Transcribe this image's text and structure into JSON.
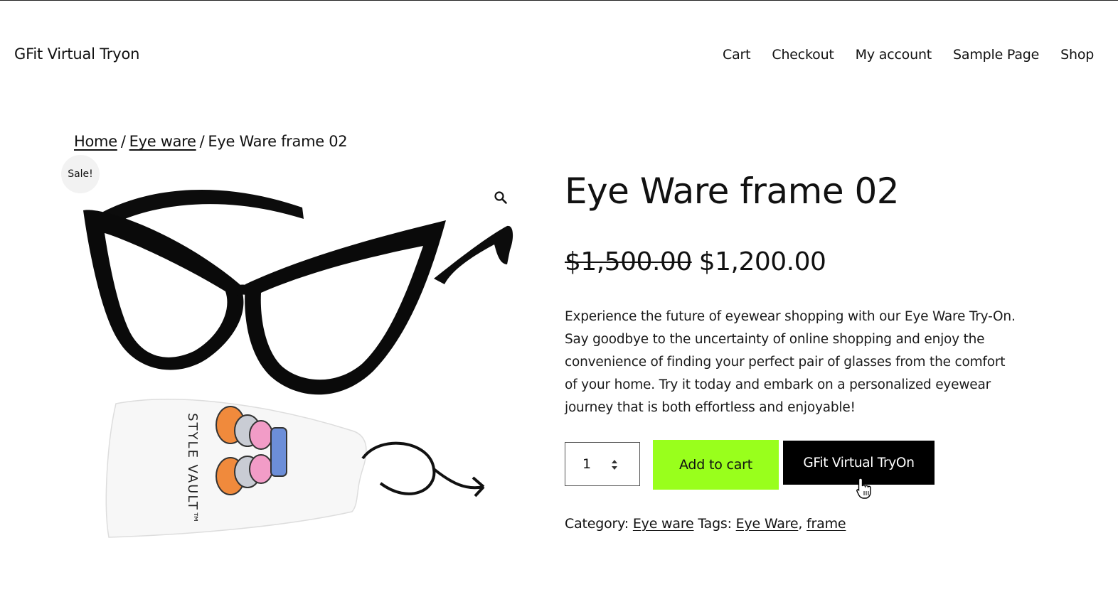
{
  "header": {
    "site_title": "GFit Virtual Tryon",
    "nav": [
      "Cart",
      "Checkout",
      "My account",
      "Sample Page",
      "Shop"
    ]
  },
  "breadcrumb": {
    "home": "Home",
    "separator": "/",
    "category": "Eye ware",
    "current": "Eye Ware frame 02"
  },
  "product": {
    "badge": "Sale!",
    "title": "Eye Ware frame 02",
    "price_old": "$1,500.00",
    "price_new": "$1,200.00",
    "description": "Experience the future of eyewear shopping with our Eye Ware Try-On. Say goodbye to the uncertainty of online shopping and enjoy the convenience of finding your perfect pair of glasses from the comfort of your home. Try it today and embark on a personalized eyewear journey that is both effortless and enjoyable!",
    "quantity": "1",
    "add_to_cart_label": "Add to cart",
    "tryon_label": "GFit Virtual TryOn",
    "image_case_text": "STYLE VAULT™",
    "category_label": "Category:",
    "category": "Eye ware",
    "tags_label": "Tags:",
    "tags": [
      "Eye Ware",
      "frame"
    ]
  },
  "colors": {
    "add_to_cart_bg": "#99ff1c",
    "tryon_bg": "#000000",
    "sale_badge_bg": "#f2f2f2"
  },
  "icons": {
    "zoom": "magnifier-icon",
    "cursor": "hand-pointer-icon"
  }
}
